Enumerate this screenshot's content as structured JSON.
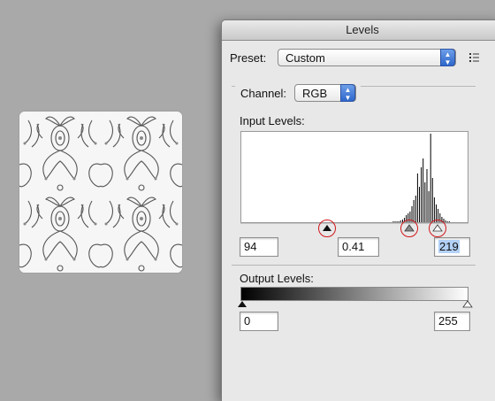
{
  "dialog": {
    "title": "Levels",
    "preset_label": "Preset:",
    "preset_value": "Custom",
    "channel_label": "Channel:",
    "channel_value": "RGB",
    "input_levels_label": "Input Levels:",
    "output_levels_label": "Output Levels:",
    "input_black": "94",
    "input_gamma": "0.41",
    "input_white": "219",
    "output_black": "0",
    "output_white": "255"
  },
  "icons": {
    "preset_menu": "list-menu-icon",
    "stepper": "up-down-arrows-icon",
    "black_point": "black-triangle-slider-icon",
    "gamma": "gray-triangle-slider-icon",
    "white_point": "white-triangle-slider-icon"
  },
  "colors": {
    "highlight_circle": "#d0181c",
    "selection": "#b3d1f6",
    "stepper_blue": "#2e67cc"
  },
  "histogram": {
    "bars": [
      0,
      0,
      0,
      0,
      0,
      0,
      0,
      0,
      0,
      0,
      0,
      0,
      0,
      0,
      0,
      0,
      0,
      0,
      0,
      0,
      0,
      0,
      0,
      0,
      0,
      0,
      0,
      0,
      0,
      0,
      0,
      0,
      0,
      0,
      0,
      0,
      0,
      0,
      0,
      0,
      0,
      0,
      0,
      0,
      0,
      0,
      0,
      0,
      0,
      0,
      0,
      0,
      0,
      0,
      0,
      0,
      0,
      0,
      0,
      0,
      0,
      0,
      0,
      0,
      0,
      0,
      0,
      0,
      0,
      0,
      0,
      0,
      0,
      0,
      0,
      0,
      0,
      0,
      0,
      0,
      0,
      0,
      0,
      0,
      0,
      0,
      0,
      0,
      0,
      0,
      0,
      0,
      0,
      0,
      0,
      0,
      0,
      0,
      0,
      0,
      0,
      0,
      0,
      0,
      0,
      0,
      0,
      0,
      0,
      0,
      0,
      0,
      0,
      0,
      0,
      0,
      0,
      0,
      0,
      0,
      0,
      0,
      0,
      0,
      0,
      0,
      0,
      0,
      0,
      0,
      0,
      0,
      0,
      0,
      0,
      0,
      0,
      0,
      0,
      0,
      0,
      0,
      0,
      0,
      0,
      0,
      0,
      0,
      0,
      0,
      0,
      0,
      0,
      0,
      0,
      0,
      0,
      0,
      0,
      0,
      0,
      0,
      1,
      0,
      1,
      0,
      1,
      0,
      1,
      0,
      2,
      0,
      3,
      0,
      5,
      0,
      8,
      0,
      10,
      0,
      12,
      0,
      18,
      0,
      25,
      0,
      30,
      0,
      55,
      0,
      40,
      0,
      62,
      0,
      72,
      0,
      45,
      0,
      60,
      0,
      35,
      0,
      100,
      0,
      50,
      0,
      28,
      0,
      20,
      0,
      15,
      0,
      10,
      0,
      6,
      0,
      4,
      0,
      2,
      0,
      1,
      0,
      1,
      0,
      0,
      0,
      0,
      0,
      0,
      0,
      0,
      0,
      0,
      0,
      0,
      0,
      0,
      0,
      0,
      0,
      0,
      0
    ]
  }
}
